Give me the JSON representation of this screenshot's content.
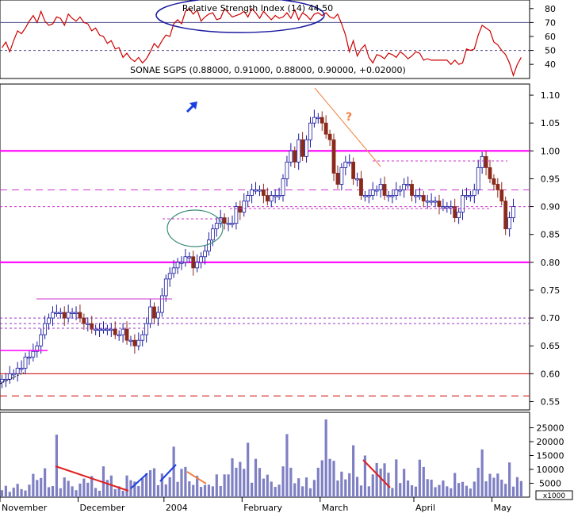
{
  "chart_data": [
    {
      "panel": "rsi",
      "type": "line",
      "title": "Relative Strength Index (14) 44.50",
      "y_ticks": [
        40,
        50,
        60,
        70,
        80
      ],
      "ylim": [
        31,
        85
      ],
      "reference_lines": [
        {
          "value": 70,
          "style": "solid",
          "color": "#4b4b8a"
        },
        {
          "value": 50,
          "style": "dashed",
          "color": "#4b4b8a"
        }
      ],
      "series": [
        {
          "values": [
            52,
            56,
            49,
            57,
            64,
            62,
            66,
            71,
            75,
            70,
            78,
            71,
            68,
            69,
            74,
            73,
            68,
            76,
            73,
            71,
            74,
            70,
            69,
            64,
            66,
            61,
            60,
            55,
            57,
            51,
            52,
            45,
            48,
            44,
            42,
            45,
            41,
            44,
            49,
            55,
            52,
            57,
            61,
            60,
            69,
            72,
            69,
            78,
            80,
            76,
            79,
            71,
            74,
            76,
            77,
            72,
            73,
            80,
            77,
            74,
            75,
            76,
            78,
            74,
            80,
            77,
            73,
            78,
            75,
            72,
            75,
            73,
            74,
            77,
            73,
            79,
            72,
            77,
            75,
            72,
            76,
            77,
            75,
            77,
            74,
            73,
            76,
            69,
            61,
            49,
            57,
            46,
            51,
            54,
            45,
            41,
            47,
            46,
            44,
            48,
            47,
            45,
            49,
            47,
            44,
            46,
            49,
            48,
            43,
            44,
            43,
            43,
            43,
            43,
            43,
            40,
            43,
            40,
            41,
            51,
            50,
            51,
            61,
            68,
            66,
            64,
            56,
            54,
            50,
            47,
            41,
            32,
            40,
            45
          ],
          "color": "#cc0000"
        }
      ]
    },
    {
      "panel": "price",
      "type": "candlestick",
      "title": "SONAE SGPS (0.88000, 0.91000, 0.88000, 0.90000, +0.02000)",
      "y_ticks": [
        0.55,
        0.6,
        0.65,
        0.7,
        0.75,
        0.8,
        0.85,
        0.9,
        0.95,
        1.0,
        1.05,
        1.1
      ],
      "ylim": [
        0.535,
        1.12
      ],
      "horizontal_lines": [
        {
          "value": 1.0,
          "style": "solid-thick",
          "color": "#ff00ff"
        },
        {
          "value": 0.93,
          "style": "dashed-long",
          "color": "#cc33cc"
        },
        {
          "value": 0.9,
          "style": "dashed",
          "color": "#cc33cc"
        },
        {
          "value": 0.8,
          "style": "solid-thick",
          "color": "#ff00ff"
        },
        {
          "value": 0.7,
          "style": "dashed",
          "color": "#9933cc"
        },
        {
          "value": 0.69,
          "style": "dashed",
          "color": "#9933cc"
        },
        {
          "value": 0.6,
          "style": "solid",
          "color": "#cc0000"
        },
        {
          "value": 0.56,
          "style": "dashed-long",
          "color": "#cc0000"
        }
      ],
      "annotations": [
        "?"
      ],
      "close": [
        0.59,
        0.59,
        0.6,
        0.6,
        0.61,
        0.61,
        0.63,
        0.63,
        0.64,
        0.65,
        0.67,
        0.69,
        0.7,
        0.71,
        0.71,
        0.71,
        0.7,
        0.71,
        0.71,
        0.71,
        0.7,
        0.69,
        0.69,
        0.68,
        0.68,
        0.68,
        0.68,
        0.68,
        0.68,
        0.67,
        0.67,
        0.68,
        0.66,
        0.66,
        0.65,
        0.66,
        0.67,
        0.69,
        0.72,
        0.7,
        0.71,
        0.74,
        0.77,
        0.78,
        0.79,
        0.8,
        0.8,
        0.81,
        0.81,
        0.79,
        0.8,
        0.81,
        0.82,
        0.84,
        0.86,
        0.87,
        0.88,
        0.87,
        0.87,
        0.87,
        0.9,
        0.89,
        0.91,
        0.92,
        0.93,
        0.93,
        0.93,
        0.92,
        0.91,
        0.92,
        0.92,
        0.92,
        0.95,
        0.98,
        1,
        0.98,
        1.02,
        0.99,
        1.02,
        1.05,
        1.06,
        1.06,
        1.05,
        1.03,
        1.02,
        0.96,
        0.94,
        0.97,
        0.98,
        0.98,
        0.95,
        0.95,
        0.92,
        0.92,
        0.92,
        0.93,
        0.93,
        0.94,
        0.92,
        0.92,
        0.92,
        0.93,
        0.93,
        0.94,
        0.94,
        0.92,
        0.92,
        0.92,
        0.91,
        0.91,
        0.91,
        0.91,
        0.9,
        0.9,
        0.9,
        0.9,
        0.88,
        0.89,
        0.92,
        0.92,
        0.92,
        0.93,
        0.97,
        0.99,
        0.97,
        0.95,
        0.94,
        0.93,
        0.91,
        0.86,
        0.88,
        0.9
      ]
    },
    {
      "panel": "volume",
      "type": "bar",
      "y_ticks": [
        5000,
        10000,
        15000,
        20000,
        25000
      ],
      "ylim": [
        0,
        30000
      ],
      "unit_label": "x1000",
      "x_tick_labels": [
        "November",
        "December",
        "2004",
        "February",
        "March",
        "April",
        "May"
      ],
      "values": [
        2500,
        4100,
        1900,
        3400,
        4800,
        2900,
        2400,
        4500,
        8400,
        6200,
        6900,
        10400,
        3600,
        4000,
        22500,
        3200,
        7100,
        5900,
        3900,
        2500,
        4900,
        6700,
        5200,
        7600,
        3300,
        2300,
        11100,
        6200,
        7800,
        2900,
        3900,
        2300,
        7800,
        6100,
        5600,
        4000,
        6700,
        8500,
        9700,
        10400,
        4300,
        8500,
        4600,
        7200,
        18200,
        5500,
        10200,
        10900,
        5700,
        4400,
        7700,
        3700,
        4400,
        4500,
        3900,
        8200,
        4000,
        8200,
        8200,
        14000,
        10600,
        12700,
        10200,
        19600,
        5200,
        13800,
        10500,
        6700,
        8100,
        5600,
        3700,
        4500,
        11100,
        22700,
        10600,
        5000,
        6800,
        3900,
        7100,
        3200,
        6200,
        10600,
        13300,
        28000,
        13800,
        13100,
        6000,
        9200,
        6400,
        8600,
        18700,
        7300,
        4200,
        15000,
        3900,
        8200,
        12300,
        10300,
        12200,
        8800,
        3300,
        13600,
        5100,
        10200,
        6000,
        4300,
        3800,
        13500,
        10900,
        6500,
        6300,
        3600,
        4400,
        6000,
        3900,
        3200,
        8700,
        5100,
        5500,
        4100,
        3100,
        5600,
        10600,
        17200,
        5700,
        8400,
        7000,
        8500,
        6300,
        4800,
        12500,
        3800,
        7200,
        5800
      ]
    }
  ]
}
